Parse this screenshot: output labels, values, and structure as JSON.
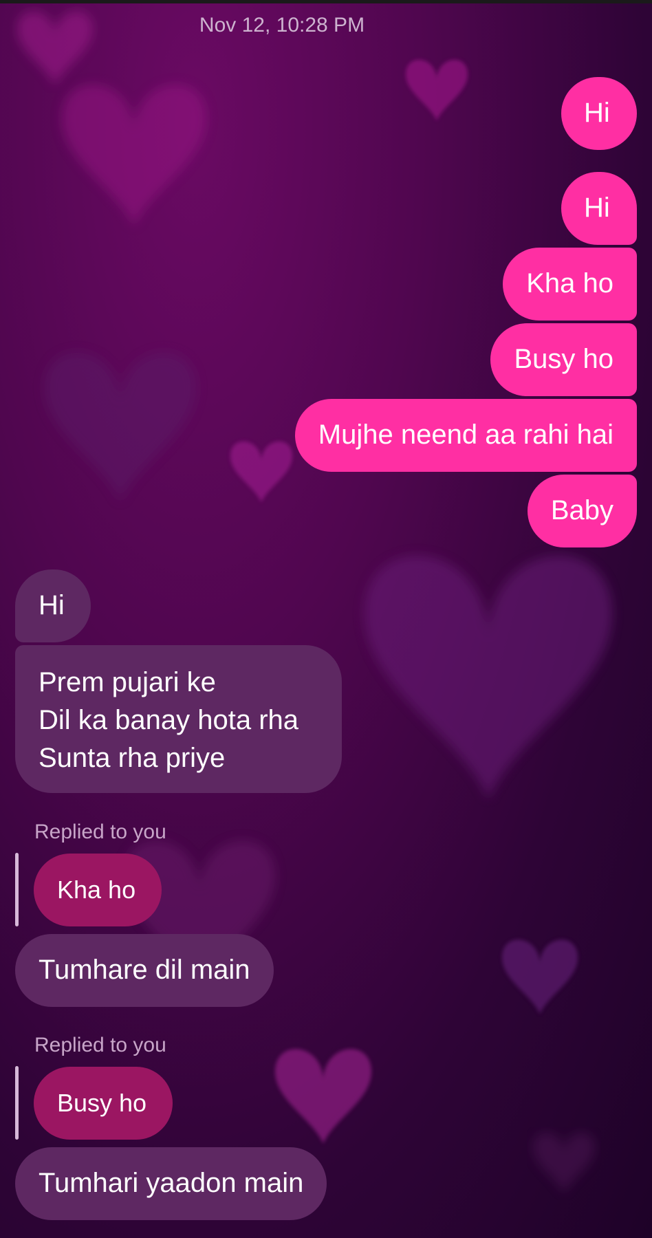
{
  "timestamp": "Nov 12, 10:28 PM",
  "sent_messages": [
    "Hi",
    "Hi",
    "Kha ho",
    "Busy ho",
    "Mujhe neend aa rahi hai",
    "Baby"
  ],
  "received": {
    "hi": "Hi",
    "poem_lines": [
      "Prem pujari ke",
      "Dil ka banay hota rha",
      "Sunta rha priye"
    ]
  },
  "replies": [
    {
      "label": "Replied to you",
      "quoted": "Kha ho",
      "message": "Tumhare dil main"
    },
    {
      "label": "Replied to you",
      "quoted": "Busy ho",
      "message": "Tumhari yaadon main"
    }
  ],
  "colors": {
    "sent_bubble": "#ff2fa3",
    "received_bubble": "#5e2862",
    "quoted_bubble": "#9b1662",
    "background": "#3a0440"
  },
  "icons": [
    "heart-icon"
  ]
}
